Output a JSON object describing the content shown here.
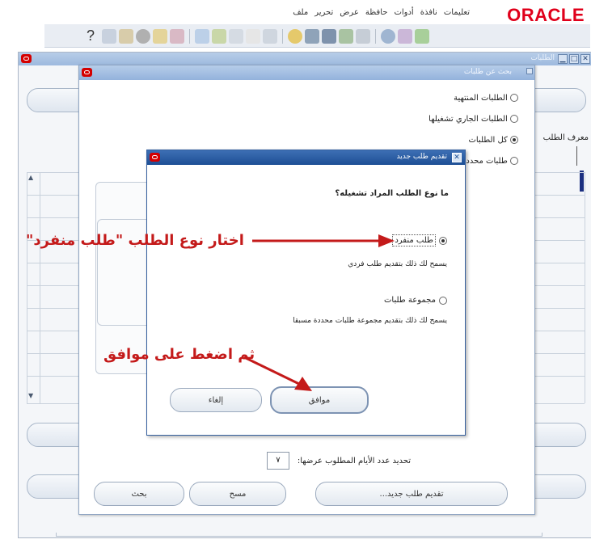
{
  "app": {
    "logo": "ORACLE",
    "menu": [
      "ملف",
      "تحرير",
      "عرض",
      "حافظة",
      "أدوات",
      "نافذة",
      "تعليمات"
    ],
    "help_symbol": "?"
  },
  "background_window": {
    "title": "الطلبات",
    "column_label": "معرف الطلب"
  },
  "search_dialog": {
    "title": "بحث عن طلبات",
    "options": [
      {
        "label": "الطلبات المنتهية",
        "selected": false
      },
      {
        "label": "الطلبات الجاري تشغيلها",
        "selected": false
      },
      {
        "label": "كل الطلبات",
        "selected": true
      },
      {
        "label": "طلبات محددة",
        "selected": false
      }
    ],
    "days_label": "تحديد عدد الأيام المطلوب عرضها:",
    "days_value": "٧",
    "submit_button": "تقديم طلب جديد...",
    "clear_button": "مسح",
    "find_button": "بحث"
  },
  "submit_dialog": {
    "title": "تقديم طلب جديد",
    "question": "ما نوع الطلب المراد تشغيله؟",
    "option_single": "طلب منفرد",
    "option_single_desc": "يسمح لك ذلك بتقديم طلب فردي",
    "option_set": "مجموعة طلبات",
    "option_set_desc": "يسمح لك ذلك بتقديم مجموعة طلبات محددة مسبقا",
    "ok_button": "موافق",
    "cancel_button": "إلغاء",
    "selected_option": "طلب منفرد"
  },
  "annotations": {
    "choose_type": "اختار نوع الطلب \"طلب منفرد\"",
    "then_ok": "ثم اضغط على موافق",
    "color": "#c41a1a"
  },
  "colors": {
    "oracle_red": "#e0001b",
    "active_title": "#1e4f95",
    "inactive_title": "#9db9de"
  }
}
